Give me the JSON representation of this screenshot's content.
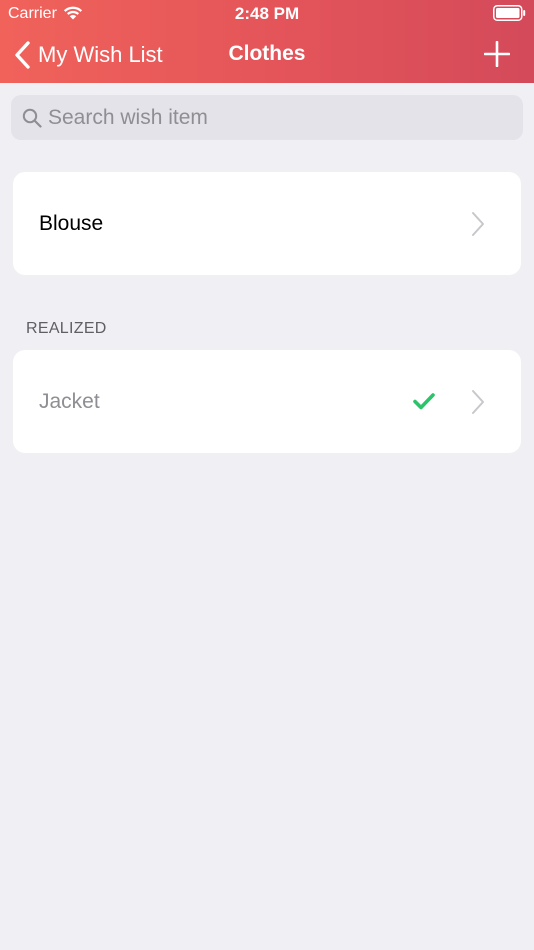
{
  "status_bar": {
    "carrier": "Carrier",
    "time": "2:48 PM"
  },
  "nav": {
    "back_label": "My Wish List",
    "title": "Clothes"
  },
  "search": {
    "placeholder": "Search wish item",
    "value": ""
  },
  "wish_items": [
    {
      "label": "Blouse"
    }
  ],
  "realized_section": {
    "header": "REALIZED",
    "items": [
      {
        "label": "Jacket"
      }
    ]
  },
  "colors": {
    "header_gradient_start": "#f0625a",
    "header_gradient_end": "#d44a5a",
    "background": "#efeff4",
    "check_green": "#2bc46a",
    "realized_text": "#8e8e93"
  },
  "icons": {
    "back": "chevron-left-icon",
    "add": "plus-icon",
    "search": "search-icon",
    "row_disclosure": "chevron-right-icon",
    "realized_mark": "checkmark-icon"
  }
}
